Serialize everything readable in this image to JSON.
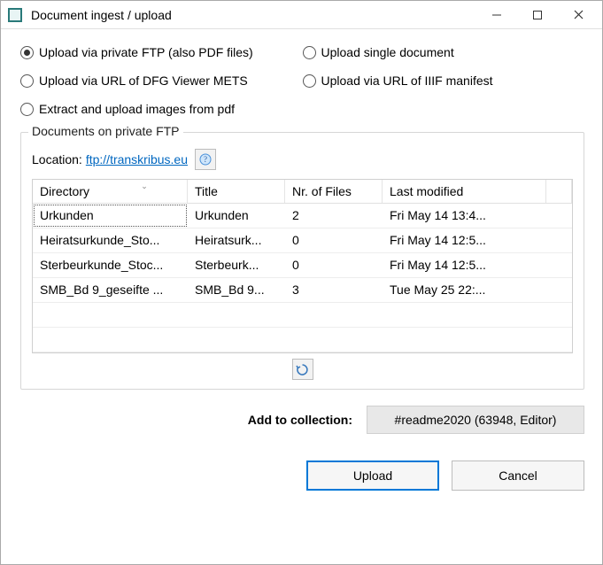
{
  "window": {
    "title": "Document ingest / upload"
  },
  "radios": {
    "ftp": "Upload via private FTP (also PDF files)",
    "single": "Upload single document",
    "mets": "Upload via URL of DFG Viewer METS",
    "iiif": "Upload via URL of IIIF manifest",
    "pdf": "Extract and upload images from pdf"
  },
  "group": {
    "title": "Documents on private FTP",
    "location_label": "Location:",
    "location_url": "ftp://transkribus.eu"
  },
  "table": {
    "headers": {
      "directory": "Directory",
      "title": "Title",
      "nr_files": "Nr. of Files",
      "last_modified": "Last modified"
    },
    "rows": [
      {
        "directory": "Urkunden",
        "title": "Urkunden",
        "nr_files": "2",
        "last_modified": "Fri May 14 13:4...",
        "selected": true
      },
      {
        "directory": "Heiratsurkunde_Sto...",
        "title": "Heiratsurk...",
        "nr_files": "0",
        "last_modified": "Fri May 14 12:5...",
        "selected": false
      },
      {
        "directory": "Sterbeurkunde_Stoc...",
        "title": "Sterbeurk...",
        "nr_files": "0",
        "last_modified": "Fri May 14 12:5...",
        "selected": false
      },
      {
        "directory": "SMB_Bd 9_geseifte ...",
        "title": "SMB_Bd 9...",
        "nr_files": "3",
        "last_modified": "Tue May 25 22:...",
        "selected": false
      }
    ]
  },
  "add_collection": {
    "label": "Add to collection:",
    "value": "#readme2020 (63948, Editor)"
  },
  "buttons": {
    "upload": "Upload",
    "cancel": "Cancel"
  }
}
